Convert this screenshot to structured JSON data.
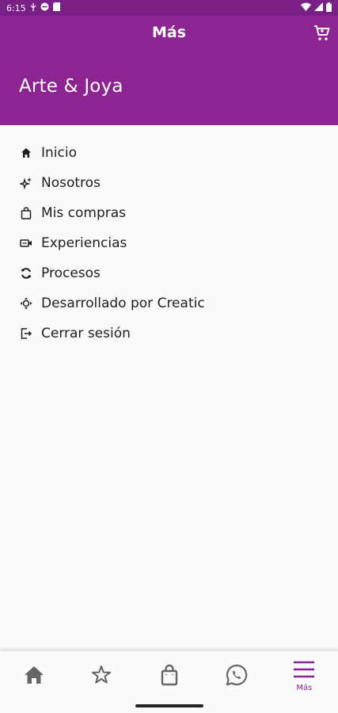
{
  "status_bar": {
    "time": "6:15",
    "icons": [
      "usb-icon",
      "do-not-disturb-icon",
      "sd-card-icon"
    ],
    "right_icons": [
      "wifi-icon",
      "signal-icon",
      "battery-icon"
    ]
  },
  "app_bar": {
    "title": "Más",
    "brand": "Arte & Joya",
    "cart_icon": "cart-icon",
    "background": "#8c2492"
  },
  "menu": {
    "items": [
      {
        "label": "Inicio",
        "icon": "home-icon"
      },
      {
        "label": "Nosotros",
        "icon": "sparkle-icon"
      },
      {
        "label": "Mis compras",
        "icon": "shopping-bag-icon"
      },
      {
        "label": "Experiencias",
        "icon": "video-camera-icon"
      },
      {
        "label": "Procesos",
        "icon": "sync-icon"
      },
      {
        "label": "Desarrollado por Creatic",
        "icon": "move-arrows-icon"
      },
      {
        "label": "Cerrar sesión",
        "icon": "logout-icon"
      }
    ]
  },
  "bottom_nav": {
    "items": [
      {
        "label": "",
        "icon": "home-icon"
      },
      {
        "label": "",
        "icon": "star-icon"
      },
      {
        "label": "",
        "icon": "shopping-bag-icon"
      },
      {
        "label": "",
        "icon": "whatsapp-icon"
      },
      {
        "label": "Más",
        "icon": "menu-icon"
      }
    ],
    "active_index": 4,
    "active_color": "#8c2492",
    "inactive_color": "#666666"
  }
}
